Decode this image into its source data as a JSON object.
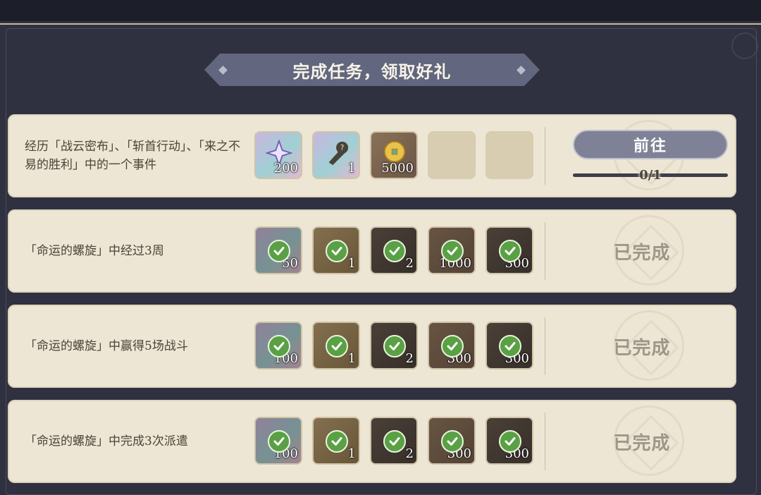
{
  "header": {
    "title": "完成任务，领取好礼"
  },
  "colors": {
    "card_bg": "#ede6d4",
    "check_green": "#5aa044",
    "button_bg": "#7f8297",
    "banner_bg": "#62667e"
  },
  "tasks": [
    {
      "description": "经历「战云密布」、「斩首行动」、「来之不易的胜利」中的一个事件",
      "status": "in_progress",
      "action_label": "前往",
      "progress_text": "0/1",
      "progress": 0,
      "rewards": [
        {
          "icon": "star-crystal-icon",
          "count": "200",
          "claimed": false
        },
        {
          "icon": "mystery-weapon-icon",
          "count": "1",
          "claimed": false
        },
        {
          "icon": "gold-coin-icon",
          "count": "5000",
          "claimed": false
        },
        {
          "icon": "empty-slot",
          "count": "",
          "claimed": false
        },
        {
          "icon": "empty-slot",
          "count": "",
          "claimed": false
        }
      ]
    },
    {
      "description": "「命运的螺旋」中经过3周",
      "status": "completed",
      "status_label": "已完成",
      "rewards": [
        {
          "icon": "star-crystal-icon",
          "count": "50",
          "claimed": true
        },
        {
          "icon": "weapon-icon",
          "count": "1",
          "claimed": true
        },
        {
          "icon": "material-icon",
          "count": "2",
          "claimed": true
        },
        {
          "icon": "coin-icon",
          "count": "1000",
          "claimed": true
        },
        {
          "icon": "gold-coin-icon",
          "count": "300",
          "claimed": true
        }
      ]
    },
    {
      "description": "「命运的螺旋」中赢得5场战斗",
      "status": "completed",
      "status_label": "已完成",
      "rewards": [
        {
          "icon": "star-crystal-icon",
          "count": "100",
          "claimed": true
        },
        {
          "icon": "weapon-icon",
          "count": "1",
          "claimed": true
        },
        {
          "icon": "material-icon",
          "count": "2",
          "claimed": true
        },
        {
          "icon": "coin-icon",
          "count": "300",
          "claimed": true
        },
        {
          "icon": "gold-coin-icon",
          "count": "300",
          "claimed": true
        }
      ]
    },
    {
      "description": "「命运的螺旋」中完成3次派遣",
      "status": "completed",
      "status_label": "已完成",
      "rewards": [
        {
          "icon": "star-crystal-icon",
          "count": "100",
          "claimed": true
        },
        {
          "icon": "weapon-icon",
          "count": "1",
          "claimed": true
        },
        {
          "icon": "material-icon",
          "count": "2",
          "claimed": true
        },
        {
          "icon": "coin-icon",
          "count": "300",
          "claimed": true
        },
        {
          "icon": "gold-coin-icon",
          "count": "300",
          "claimed": true
        }
      ]
    }
  ]
}
